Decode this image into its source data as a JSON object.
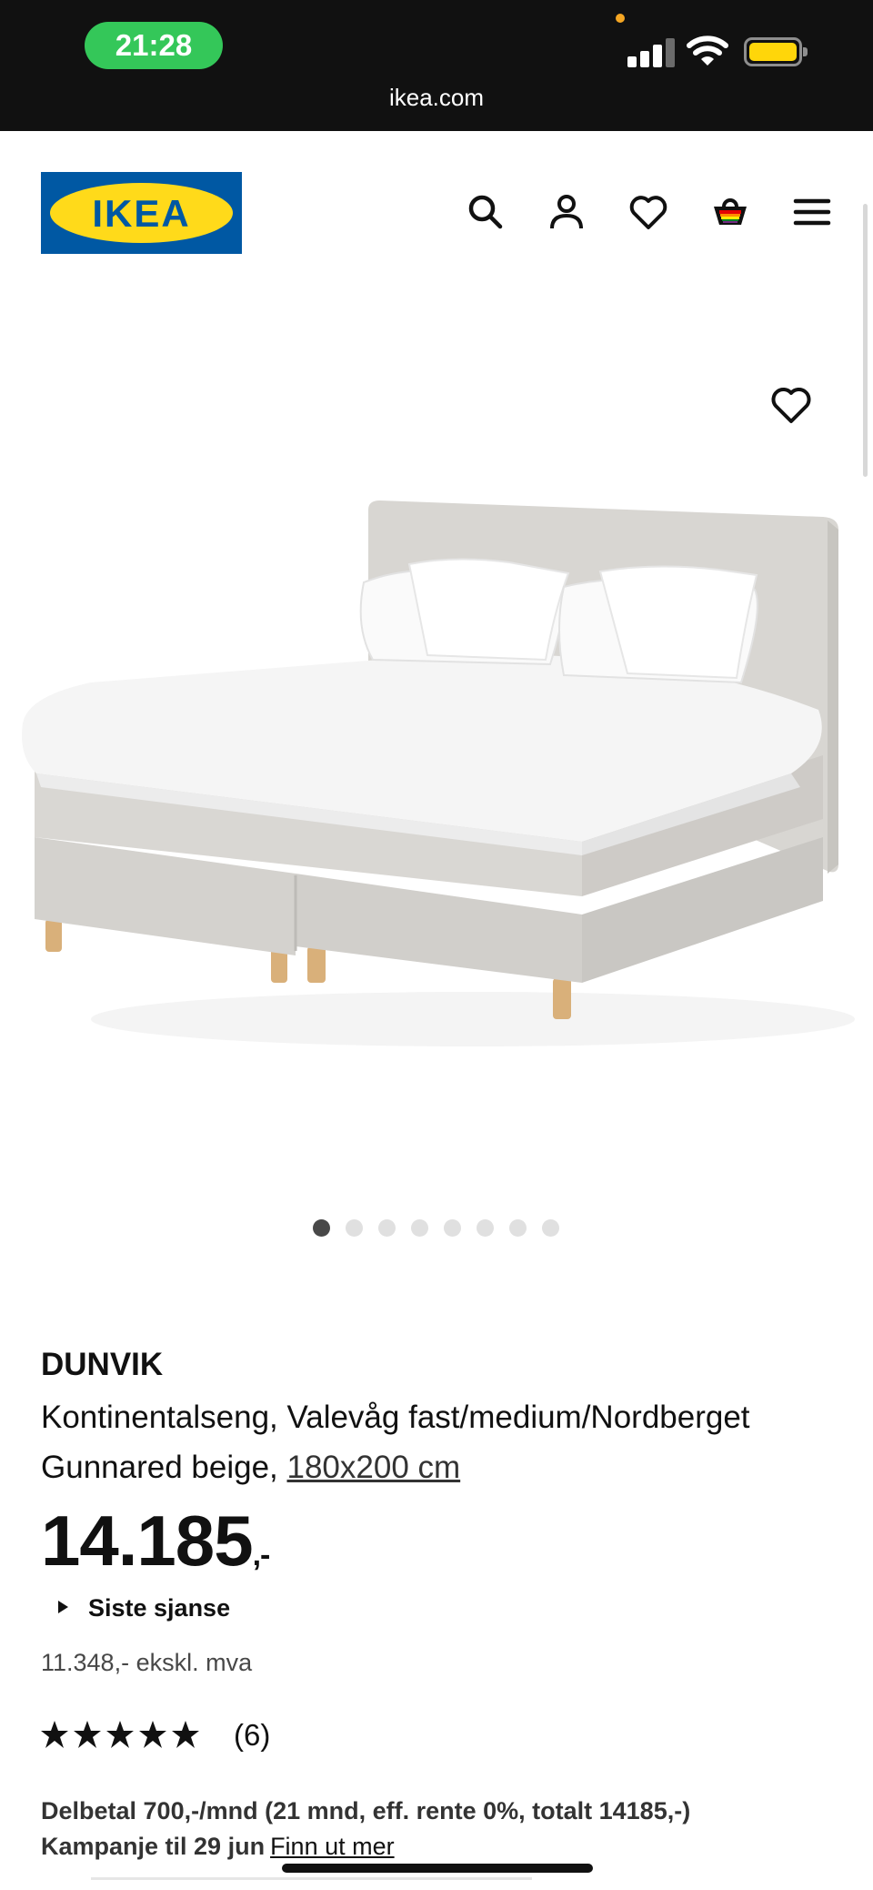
{
  "status_bar": {
    "time": "21:28",
    "url": "ikea.com",
    "battery_color": "#ffd60a",
    "time_pill_color": "#34c759"
  },
  "header": {
    "logo_text": "IKEA",
    "icons": [
      "search-icon",
      "profile-icon",
      "heart-icon",
      "cart-icon",
      "menu-icon"
    ]
  },
  "gallery": {
    "image_count": 8,
    "active_index": 0,
    "favorite_icon": "heart-icon"
  },
  "product": {
    "brand": "DUNVIK",
    "description": "Kontinentalseng, Valevåg fast/medium/Nordberget Gunnared beige,",
    "size_link": "180x200 cm",
    "price": "14.185",
    "price_suffix": ",-",
    "last_chance": "Siste sjanse",
    "ex_vat": "11.348,- ekskl. mva",
    "rating_stars": 5,
    "rating_count": "(6)",
    "installment": "Delbetal 700,-/mnd (21 mnd, eff. rente 0%, totalt 14185,-)",
    "campaign": "Kampanje til 29 jun",
    "campaign_link": "Finn ut mer"
  },
  "colors": {
    "ikea_blue": "#0058a3",
    "ikea_yellow": "#ffda1a"
  }
}
